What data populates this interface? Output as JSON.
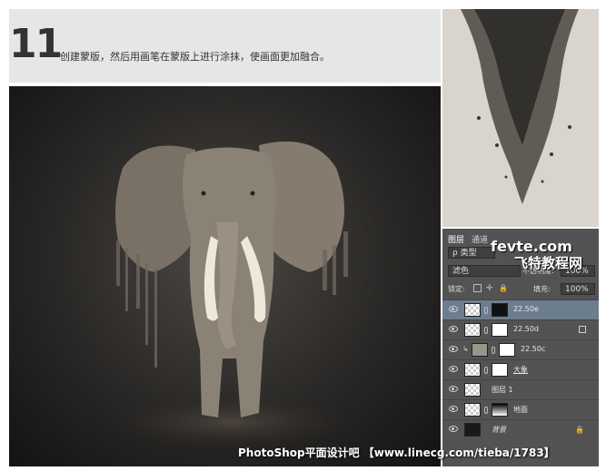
{
  "tutorial": {
    "step_number": "11",
    "instruction": "创建蒙版，然后用画笔在蒙版上进行涂抹，使画面更加融合。"
  },
  "watermarks": {
    "site_line1": "fevte.com",
    "site_line2": "飞特教程网",
    "bottom": "PhotoShop平面设计吧 【www.linecg.com/tieba/1783】"
  },
  "layers_panel": {
    "tabs": [
      "图层",
      "通道"
    ],
    "filter_label": "ρ 类型",
    "blend_mode": "滤色",
    "opacity_label": "不透明度:",
    "opacity_value": "100%",
    "lock_label": "锁定:",
    "fill_label": "填充:",
    "fill_value": "100%",
    "layers": [
      {
        "name": "22.50e",
        "selected": true
      },
      {
        "name": "22.50d",
        "selected": false
      },
      {
        "name": "22.50c",
        "selected": false
      },
      {
        "name": "大象",
        "selected": false
      },
      {
        "name": "图层 1",
        "selected": false
      },
      {
        "name": "地面",
        "selected": false
      },
      {
        "name": "背景",
        "selected": false
      }
    ]
  },
  "colors": {
    "panel_bg": "#535353",
    "selected_row": "#6d7d90",
    "strip_bg": "#e6e6e6"
  }
}
